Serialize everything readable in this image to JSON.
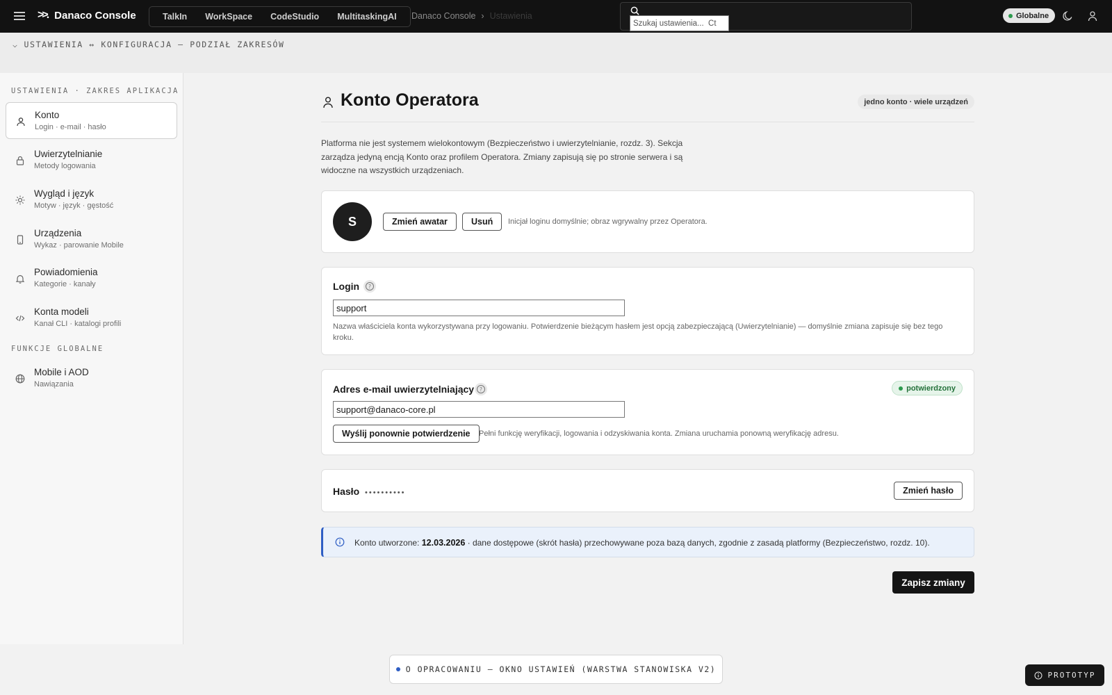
{
  "topbar": {
    "brand": "Danaco Console",
    "apps": [
      {
        "label": "TalkIn"
      },
      {
        "label": "WorkSpace"
      },
      {
        "label": "CodeStudio"
      },
      {
        "label": "MultitaskingAI"
      }
    ],
    "breadcrumb": [
      "Danaco Console",
      "Ustawienia"
    ],
    "search_placeholder": "Szukaj ustawienia...  Ct",
    "scope_badge": "Globalne"
  },
  "path_strip": {
    "text": "USTAWIENIA ↔ KONFIGURACJA — PODZIAŁ ZAKRESÓW"
  },
  "sidebar": {
    "heading_app": "USTAWIENIA · ZAKRES APLIKACJA",
    "heading_global": "FUNKCJE GLOBALNE",
    "items": [
      {
        "title": "Konto",
        "sub": "Login · e-mail · hasło",
        "icon": "user-icon"
      },
      {
        "title": "Uwierzytelnianie",
        "sub": "Metody logowania",
        "icon": "lock-icon"
      },
      {
        "title": "Wygląd i język",
        "sub": "Motyw · język · gęstość",
        "icon": "sun-icon"
      },
      {
        "title": "Urządzenia",
        "sub": "Wykaz · parowanie Mobile",
        "icon": "phone-icon"
      },
      {
        "title": "Powiadomienia",
        "sub": "Kategorie · kanały",
        "icon": "bell-icon"
      },
      {
        "title": "Konta modeli",
        "sub": "Kanał CLI · katalogi profili",
        "icon": "code-icon"
      }
    ],
    "global_items": [
      {
        "title": "Mobile i AOD",
        "sub": "Nawiązania",
        "icon": "globe-icon"
      }
    ]
  },
  "main": {
    "title": "Konto Operatora",
    "header_tag": "jedno konto · wiele urządzeń",
    "intro": "Platforma nie jest systemem wielokontowym (Bezpieczeństwo i uwierzytelnianie, rozdz. 3). Sekcja zarządza jedyną encją Konto oraz profilem Operatora. Zmiany zapisują się po stronie serwera i są widoczne na wszystkich urządzeniach.",
    "avatar": {
      "initial": "S",
      "change_label": "Zmień awatar",
      "remove_label": "Usuń",
      "hint": "Inicjał loginu domyślnie; obraz wgrywalny przez Operatora."
    },
    "login": {
      "label": "Login",
      "value": "support",
      "desc": "Nazwa właściciela konta wykorzystywana przy logowaniu. Potwierdzenie bieżącym hasłem jest opcją zabezpieczającą (Uwierzytelnianie) — domyślnie zmiana zapisuje się bez tego kroku."
    },
    "email": {
      "label": "Adres e-mail uwierzytelniający",
      "value": "support@danaco-core.pl",
      "status": "potwierdzony",
      "resend_label": "Wyślij ponownie potwierdzenie",
      "desc": "Pełni funkcję weryfikacji, logowania i odzyskiwania konta. Zmiana uruchamia ponowną weryfikację adresu."
    },
    "password": {
      "label": "Hasło",
      "mask": "••••••••••",
      "change_label": "Zmień hasło"
    },
    "info": {
      "prefix": "Konto utworzone: ",
      "date": "12.03.2026",
      "suffix": " · dane dostępowe (skrót hasła) przechowywane poza bazą danych, zgodnie z zasadą platformy (Bezpieczeństwo, rozdz. 10)."
    },
    "save_label": "Zapisz zmiany"
  },
  "footer": {
    "dev_note": "O OPRACOWANIU — OKNO USTAWIEŃ (WARSTWA STANOWISKA V2)",
    "proto_label": "PROTOTYP"
  },
  "colors": {
    "topbar": "#121212",
    "accent_blue": "#2e5ec4",
    "status_green": "#2c9a4d",
    "primary_button": "#151515"
  }
}
